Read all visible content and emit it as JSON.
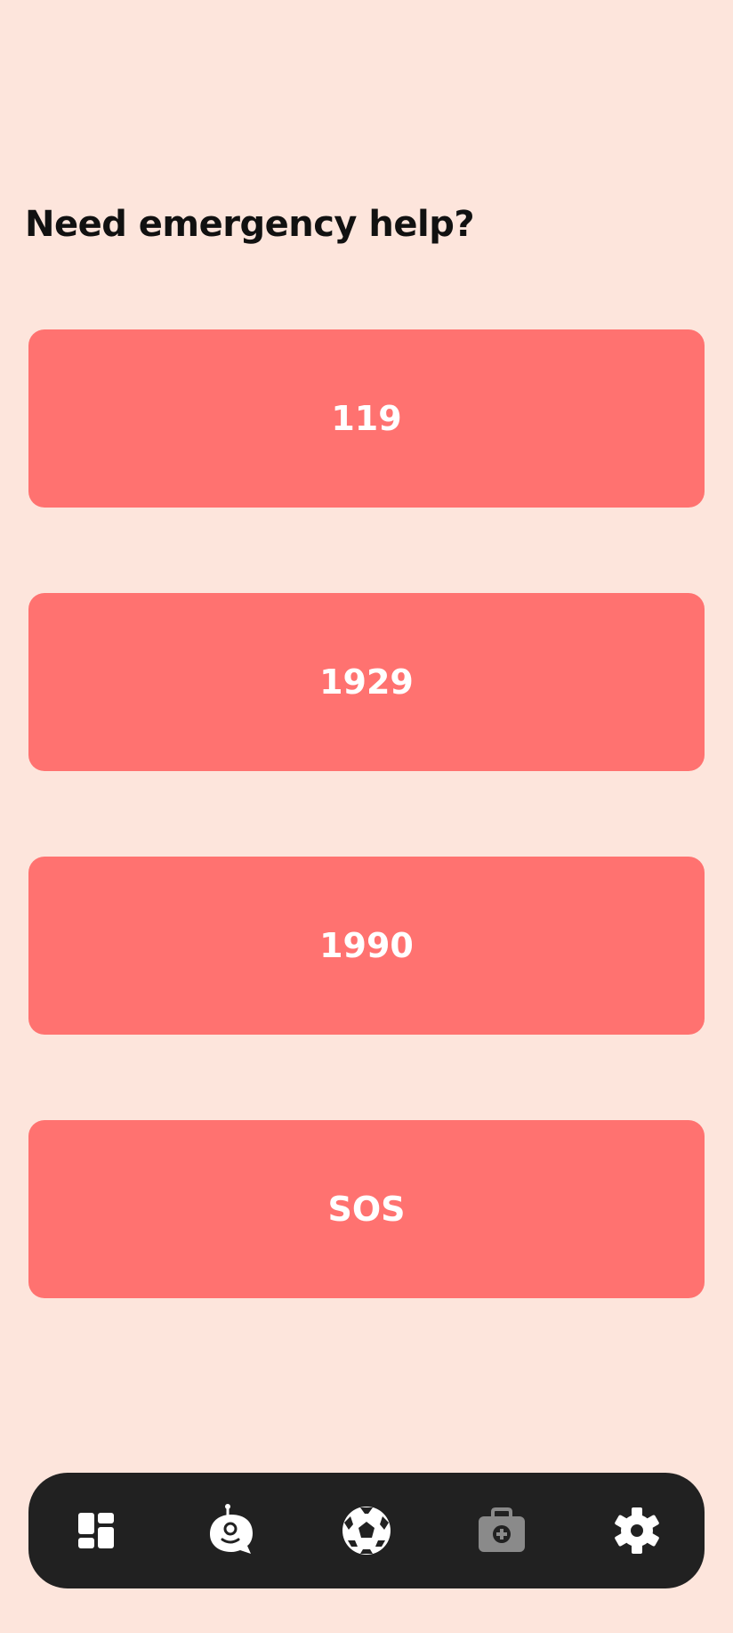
{
  "heading": "Need emergency help?",
  "emergency_buttons": [
    {
      "label": "119"
    },
    {
      "label": "1929"
    },
    {
      "label": "1990"
    },
    {
      "label": "SOS"
    }
  ],
  "bottom_nav": {
    "items": [
      {
        "icon": "dashboard-icon",
        "active": false
      },
      {
        "icon": "chat-bot-icon",
        "active": false
      },
      {
        "icon": "soccer-ball-icon",
        "active": false
      },
      {
        "icon": "medical-kit-icon",
        "active": true
      },
      {
        "icon": "settings-gear-icon",
        "active": false
      }
    ]
  },
  "colors": {
    "background": "#FDE5DC",
    "button": "#FF7270",
    "button_text": "#FFFFFF",
    "nav_background": "#212121",
    "nav_icon": "#FFFFFF",
    "nav_icon_active": "#8A8A8A"
  }
}
